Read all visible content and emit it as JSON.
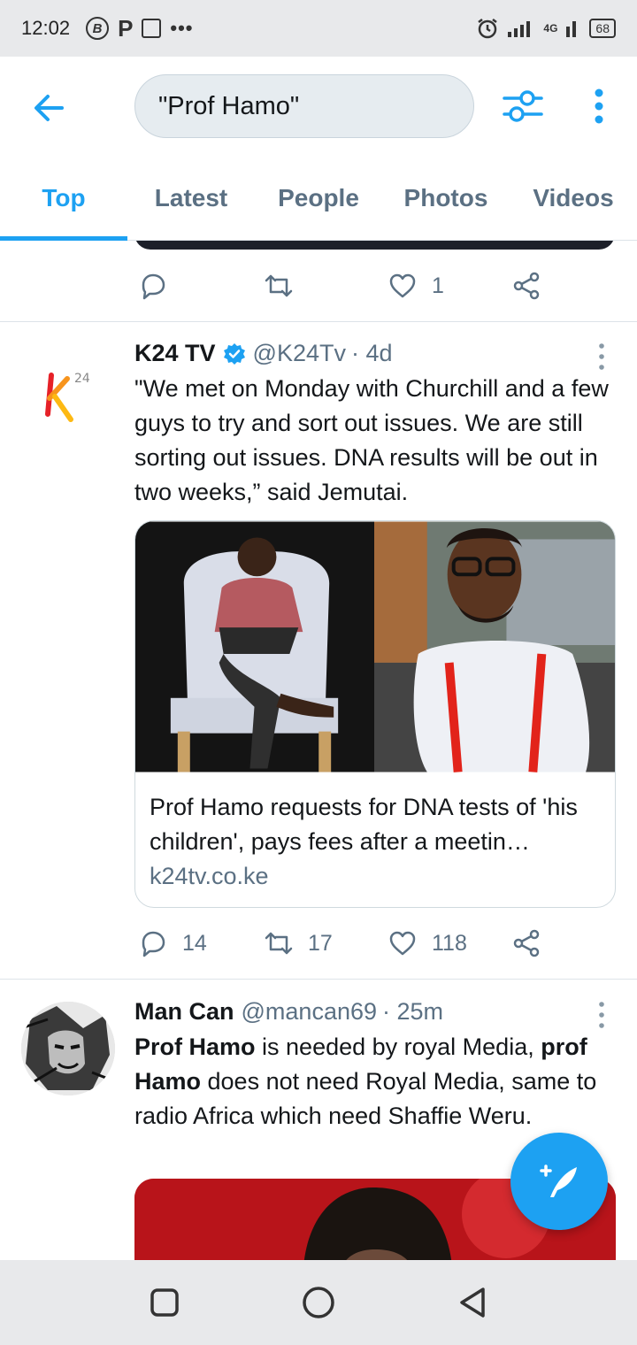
{
  "status_bar": {
    "time": "12:02",
    "left_icons": [
      "b-circle-icon",
      "p-icon",
      "news-icon",
      "more-dots-icon"
    ],
    "network": "4G",
    "battery": "68"
  },
  "search": {
    "query": "\"Prof Hamo\""
  },
  "tabs": [
    {
      "label": "Top",
      "active": true
    },
    {
      "label": "Latest",
      "active": false
    },
    {
      "label": "People",
      "active": false
    },
    {
      "label": "Photos",
      "active": false
    },
    {
      "label": "Videos",
      "active": false
    }
  ],
  "previous_tweet": {
    "likes": "1"
  },
  "tweets": [
    {
      "name": "K24 TV",
      "verified": true,
      "handle": "@K24Tv",
      "time": "· 4d",
      "text": "\"We met on Monday with Churchill and a few guys to try and sort out issues. We are still sorting out issues. DNA results will be out in two weeks,” said Jemutai.",
      "card": {
        "title": "Prof Hamo requests for DNA tests of 'his children', pays fees after a meetin…",
        "domain": "k24tv.co.ke"
      },
      "replies": "14",
      "retweets": "17",
      "likes": "118"
    },
    {
      "name": "Man Can",
      "verified": false,
      "handle": "@mancan69",
      "time": "· 25m",
      "text_parts": [
        {
          "text": "Prof Hamo",
          "bold": true
        },
        {
          "text": " is needed by royal Media, ",
          "bold": false
        },
        {
          "text": "prof Hamo",
          "bold": true
        },
        {
          "text": " does not need Royal Media, same to radio Africa which need Shaffie Weru.",
          "bold": false
        }
      ]
    }
  ],
  "colors": {
    "accent": "#1da1f2",
    "muted": "#5b7083",
    "text": "#14171a"
  }
}
